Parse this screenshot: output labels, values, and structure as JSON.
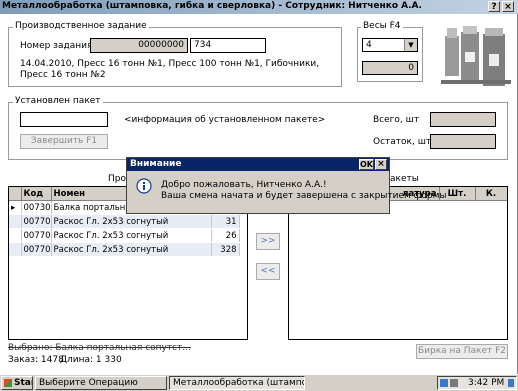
{
  "window": {
    "title": "Металлообработка (штамповка, гибка и сверловка) - Сотрудник: Нитченко А.А.",
    "help_btn": "?",
    "close_btn": "×"
  },
  "job": {
    "group_label": "Производственное задание",
    "number_label": "Номер задания",
    "number_value": "00000000",
    "number_entry": "734",
    "description": "14.04.2010, Пресс 16 тонн №1, Пресс 100 тонн №1, Гибочники, Пресс 16 тонн №2"
  },
  "scales": {
    "group_label": "Весы  F4",
    "selected": "4",
    "value": "0"
  },
  "packet": {
    "group_label": "Установлен пакет",
    "info": "<информация об установленном пакете>",
    "finish_button": "Завершить     F1",
    "total_label": "Всего, шт",
    "remaining_label": "Остаток, шт"
  },
  "products_panel": {
    "caption": "Прод",
    "columns": [
      "Код",
      "Номен"
    ],
    "rows": [
      {
        "code": "00730",
        "name": "Балка портальная",
        "qty": ""
      },
      {
        "code": "00770",
        "name": "Раскос Гл. 2х53 согнутый",
        "qty": "31"
      },
      {
        "code": "00770",
        "name": "Раскос Гл. 2х53 согнутый",
        "qty": "26"
      },
      {
        "code": "00770",
        "name": "Раскос Гл. 2х53 согнутый",
        "qty": "328"
      }
    ]
  },
  "packets_panel": {
    "caption": "акеты",
    "columns": [
      "латура",
      "Шт.",
      "К."
    ]
  },
  "move_right": ">>",
  "move_left": "<<",
  "bottom": {
    "selected_text": "Выбрано: Балка портальная сопутст...",
    "order_label": "Заказ: 1478",
    "length_label": "Длина: 1 330",
    "tag_button": "Бирка на Пакет  F2"
  },
  "dialog": {
    "title": "Внимание",
    "ok": "OK",
    "close": "×",
    "line1": "Добро пожаловать, Нитченко А.А.!",
    "line2": "Ваша смена начата и будет завершена с закрытием формы"
  },
  "taskbar": {
    "start": "Start",
    "task1": "Выберите Операцию",
    "task2": "Металлообработка (штамповка,",
    "time": "3:42 PM"
  }
}
